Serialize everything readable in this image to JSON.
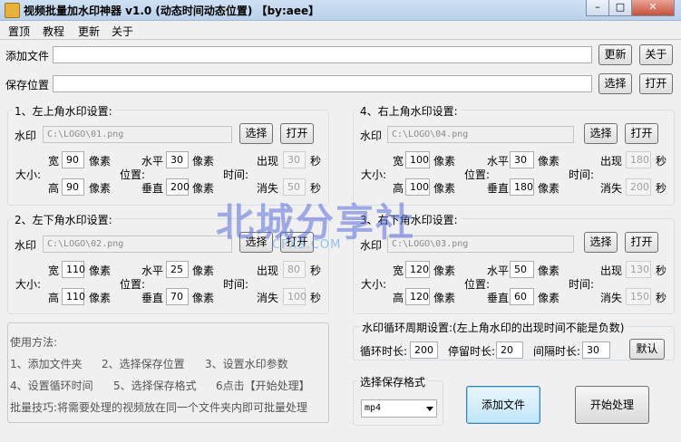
{
  "window": {
    "title": "视频批量加水印神器 v1.0 (动态时间动态位置) 【by:aee】"
  },
  "menu": [
    "置顶",
    "教程",
    "更新",
    "关于"
  ],
  "top": {
    "add_file_label": "添加文件",
    "save_path_label": "保存位置",
    "update_btn": "更新",
    "about_btn": "关于",
    "choose_btn": "选择",
    "open_btn": "打开"
  },
  "labels": {
    "watermark": "水印",
    "size": "大小:",
    "width": "宽",
    "height": "高",
    "px": "像素",
    "pos": "位置:",
    "horiz": "水平",
    "vert": "垂直",
    "time": "时间:",
    "appear": "出现",
    "disappear": "消失",
    "sec": "秒",
    "choose": "选择",
    "open": "打开"
  },
  "groups": [
    {
      "title": "1、左上角水印设置:",
      "path": "C:\\LOGO\\01.png",
      "w": "90",
      "h": "90",
      "x": "30",
      "y": "200",
      "appear": "30",
      "disappear": "50"
    },
    {
      "title": "4、右上角水印设置:",
      "path": "C:\\LOGO\\04.png",
      "w": "100",
      "h": "100",
      "x": "30",
      "y": "180",
      "appear": "180",
      "disappear": "200"
    },
    {
      "title": "2、左下角水印设置:",
      "path": "C:\\LOGO\\02.png",
      "w": "110",
      "h": "110",
      "x": "25",
      "y": "70",
      "appear": "80",
      "disappear": "100"
    },
    {
      "title": "3、右下角水印设置:",
      "path": "C:\\LOGO\\03.png",
      "w": "120",
      "h": "120",
      "x": "50",
      "y": "60",
      "appear": "130",
      "disappear": "150"
    }
  ],
  "help": {
    "title": "使用方法:",
    "step1": "1、添加文件夹",
    "step2": "2、选择保存位置",
    "step3": "3、设置水印参数",
    "step4": "4、设置循环时间",
    "step5": "5、选择保存格式",
    "step6": "6点击【开始处理】",
    "tip": "批量技巧:将需要处理的视频放在同一个文件夹内即可批量处理"
  },
  "cycle": {
    "title": "水印循环周期设置:(左上角水印的出现时间不能是负数)",
    "cycle_label": "循环时长:",
    "cycle_value": "200",
    "stay_label": "停留时长:",
    "stay_value": "20",
    "interval_label": "间隔时长:",
    "interval_value": "30",
    "default_btn": "默认"
  },
  "format": {
    "title": "选择保存格式",
    "selected": "mp4"
  },
  "actions": {
    "add_file": "添加文件",
    "start": "开始处理"
  },
  "watermark_overlay": {
    "text": "北城分享社",
    "sub": "CFXS.COM"
  }
}
